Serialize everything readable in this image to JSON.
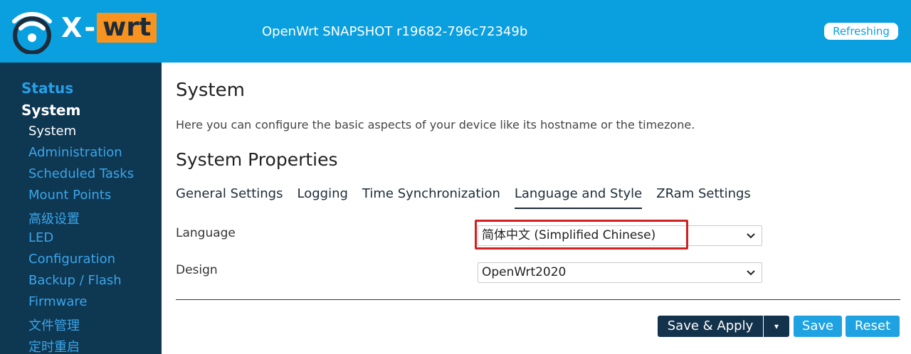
{
  "header": {
    "logo_x": "X",
    "logo_wrt": "wrt",
    "hostname": "OpenWrt SNAPSHOT r19682-796c72349b",
    "refresh_label": "Refreshing",
    "color": "#0aa0e0",
    "logo_accent": "#f7931e"
  },
  "sidebar": {
    "status": "Status",
    "system": "System",
    "items": [
      {
        "label": "System",
        "active": true
      },
      {
        "label": "Administration"
      },
      {
        "label": "Scheduled Tasks"
      },
      {
        "label": "Mount Points"
      },
      {
        "label": "高级设置"
      },
      {
        "label": "LED"
      },
      {
        "label": "Configuration"
      },
      {
        "label": "Backup / Flash"
      },
      {
        "label": "Firmware"
      },
      {
        "label": "文件管理"
      },
      {
        "label": "定时重启"
      }
    ],
    "background": "#0e3752"
  },
  "main": {
    "title": "System",
    "description": "Here you can configure the basic aspects of your device like its hostname or the timezone.",
    "section_title": "System Properties",
    "tabs": [
      {
        "label": "General Settings"
      },
      {
        "label": "Logging"
      },
      {
        "label": "Time Synchronization"
      },
      {
        "label": "Language and Style",
        "active": true
      },
      {
        "label": "ZRam Settings"
      }
    ],
    "fields": {
      "language": {
        "label": "Language",
        "value": "简体中文 (Simplified Chinese)"
      },
      "design": {
        "label": "Design",
        "value": "OpenWrt2020"
      }
    },
    "buttons": {
      "save_apply": "Save & Apply",
      "dropdown": "▾",
      "save": "Save",
      "reset": "Reset"
    },
    "highlight_color": "#d0201f"
  }
}
